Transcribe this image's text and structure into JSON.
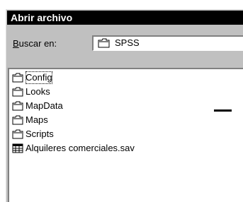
{
  "dialog": {
    "title": "Abrir archivo",
    "look_in": {
      "label": "Buscar en:",
      "mnemonic": "B",
      "label_rest": "uscar en:",
      "icon": "folder-icon",
      "value": "SPSS"
    }
  },
  "file_list": {
    "items": [
      {
        "label": "Config",
        "icon": "folder-icon",
        "focused": true
      },
      {
        "label": "Looks",
        "icon": "folder-icon"
      },
      {
        "label": "MapData",
        "icon": "folder-icon"
      },
      {
        "label": "Maps",
        "icon": "folder-icon"
      },
      {
        "label": "Scripts",
        "icon": "folder-icon"
      },
      {
        "label": "Alquileres comerciales.sav",
        "icon": "spss-data-file-icon"
      }
    ]
  }
}
